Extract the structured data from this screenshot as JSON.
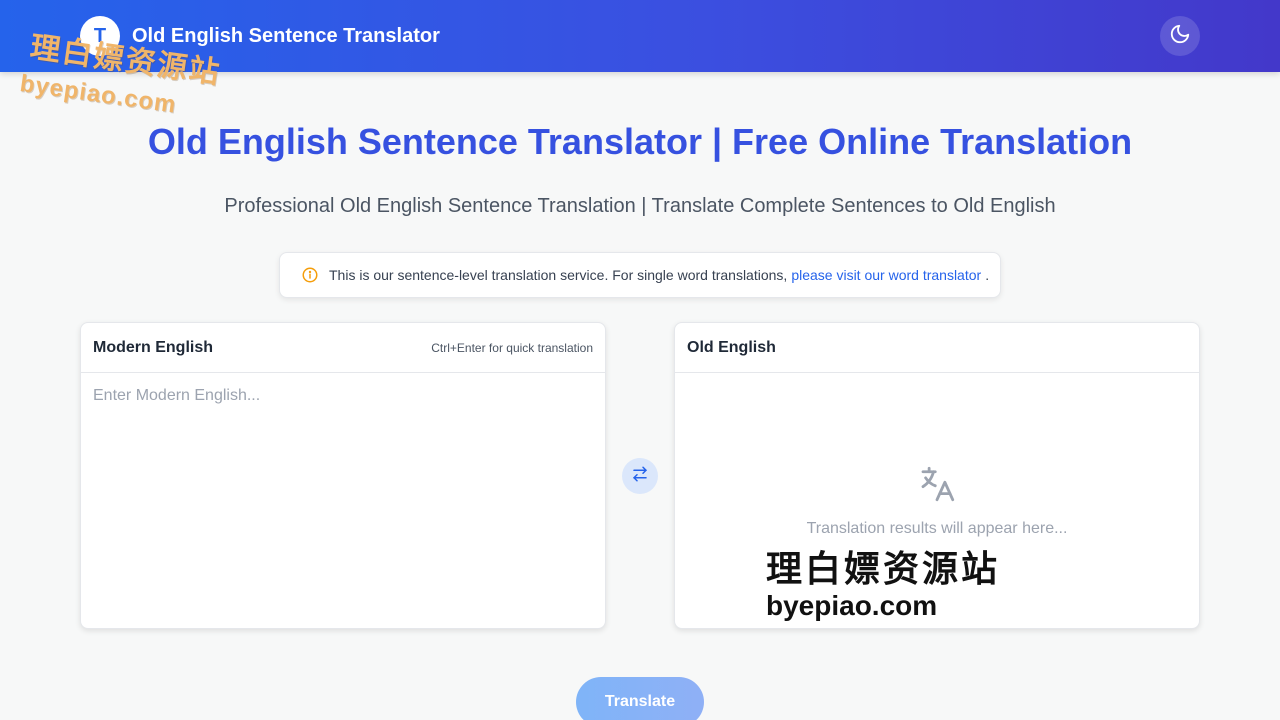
{
  "header": {
    "logo_letter": "T",
    "title": "Old English Sentence Translator",
    "theme_toggle_icon": "moon-icon"
  },
  "hero": {
    "title": "Old English Sentence Translator | Free Online Translation",
    "subtitle": "Professional Old English Sentence Translation | Translate Complete Sentences to Old English"
  },
  "notice": {
    "icon": "info-icon",
    "text": "This is our sentence-level translation service. For single word translations,",
    "link_text": "please visit our word translator",
    "suffix": "."
  },
  "source_panel": {
    "title": "Modern English",
    "hint": "Ctrl+Enter for quick translation",
    "placeholder": "Enter Modern English...",
    "value": ""
  },
  "target_panel": {
    "title": "Old English",
    "empty_icon": "translate-icon",
    "empty_text": "Translation results will appear here..."
  },
  "swap": {
    "icon": "swap-arrows-icon"
  },
  "actions": {
    "translate_label": "Translate"
  },
  "watermark": {
    "cn": "理白嫖资源站",
    "en": "byepiao.com"
  },
  "colors": {
    "header_start": "#2563eb",
    "header_end": "#4338ca",
    "hero_title": "#3651e0",
    "link": "#2563eb",
    "info_icon": "#f59e0b",
    "translate_button": "#8fb5f7"
  }
}
